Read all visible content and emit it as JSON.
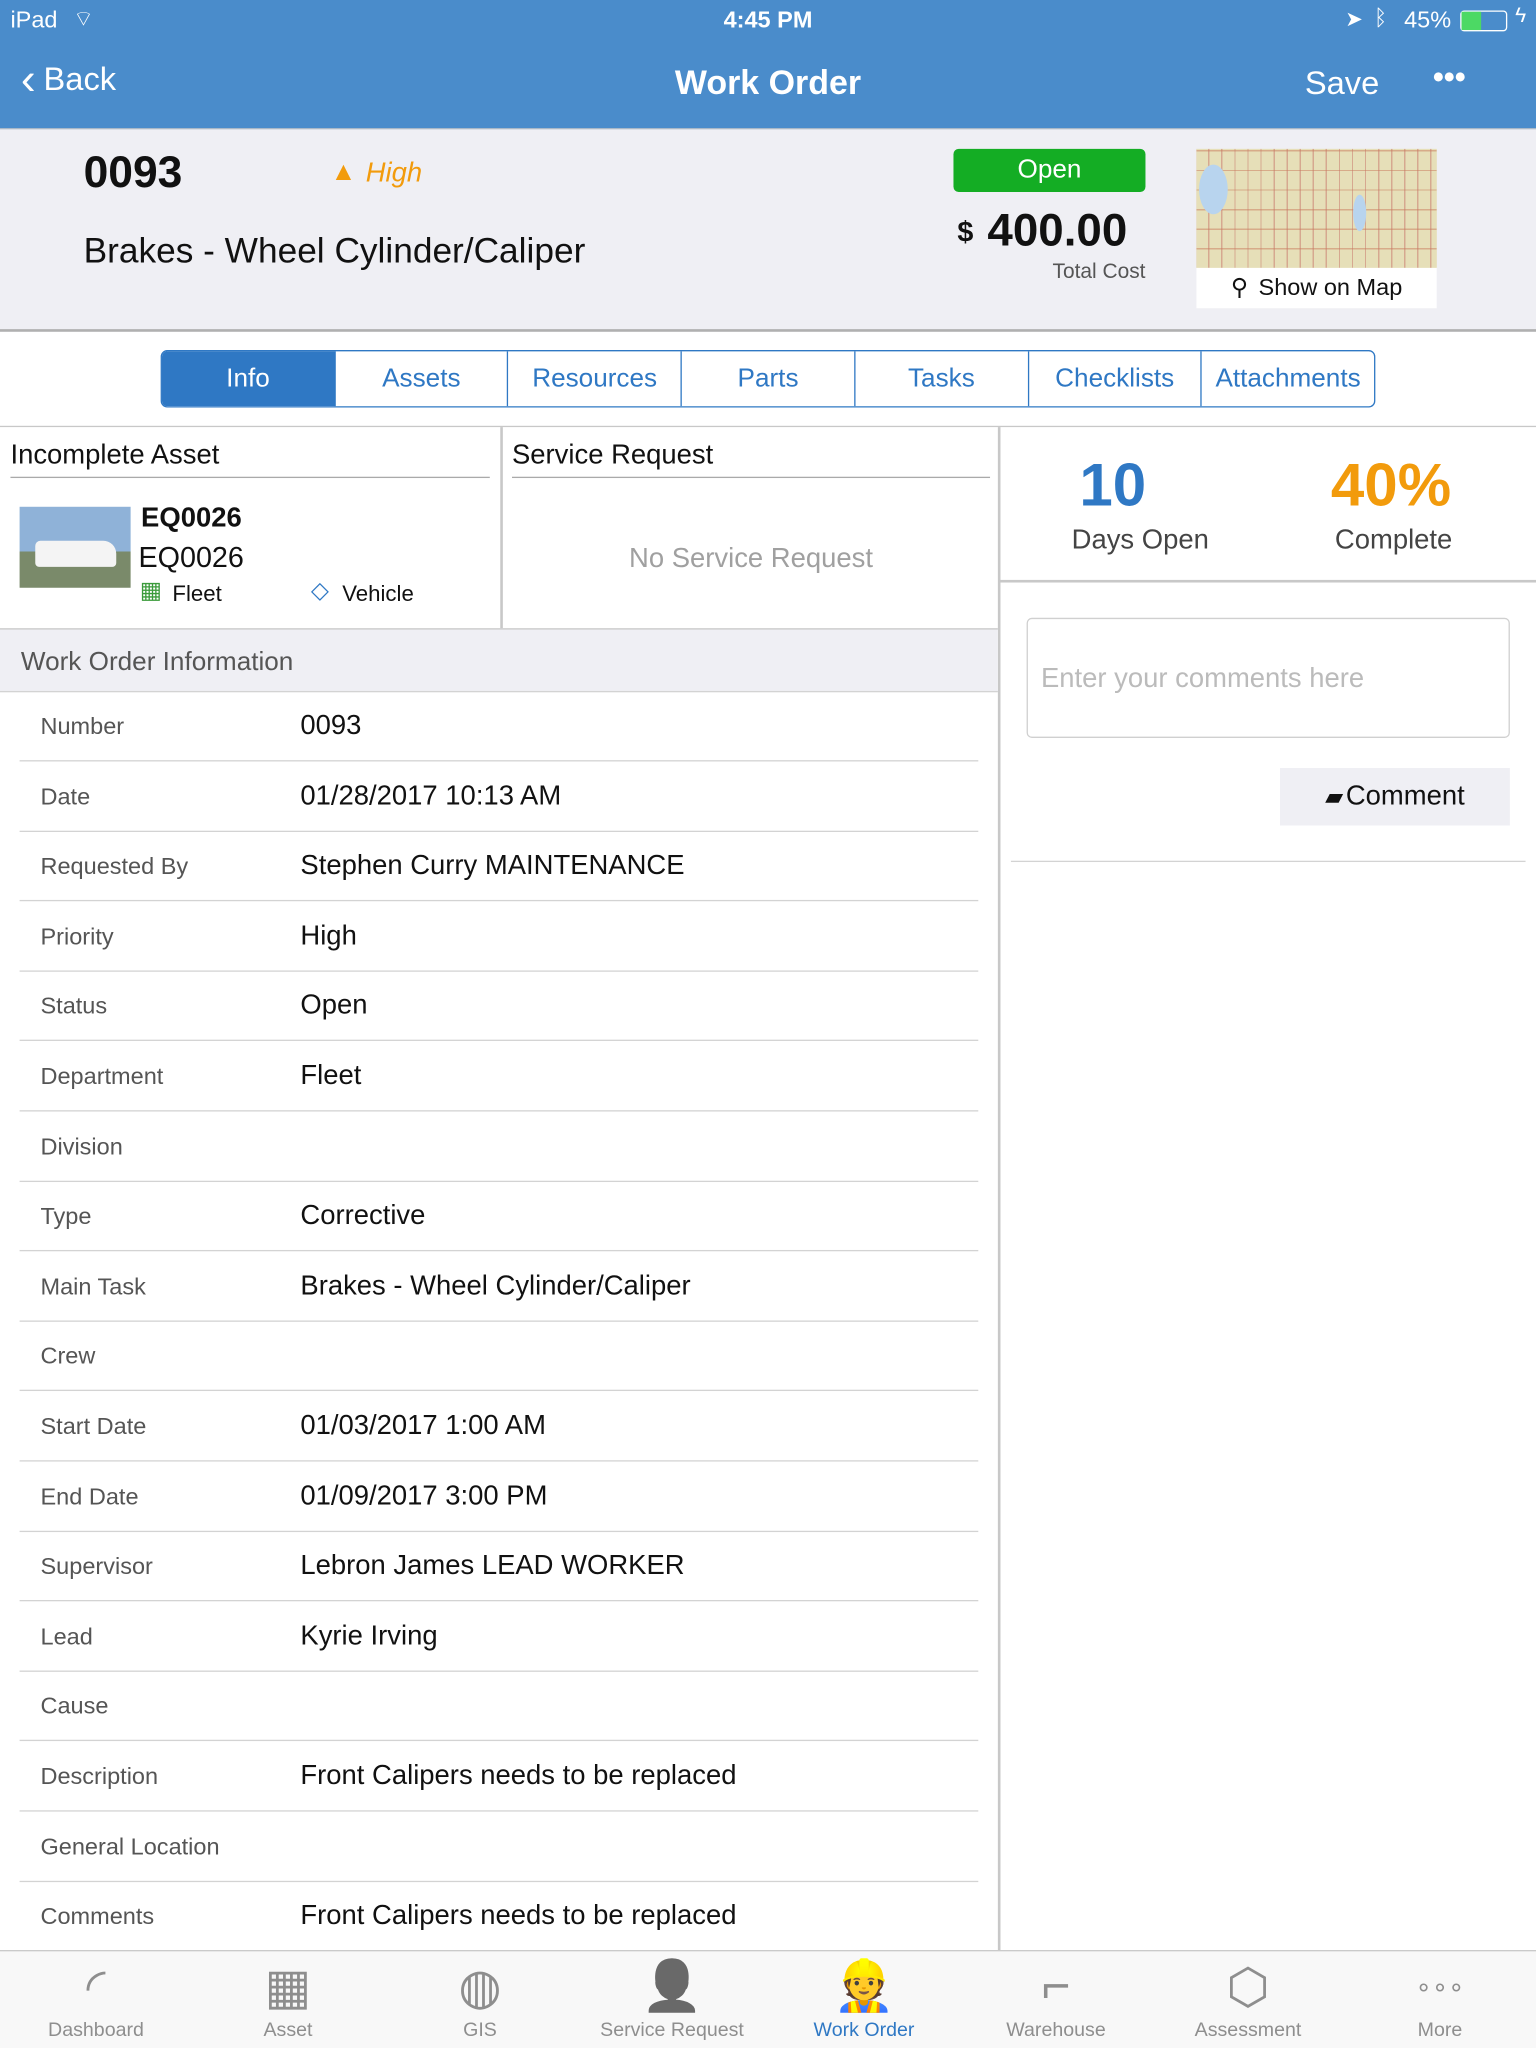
{
  "status_bar": {
    "device": "iPad",
    "time": "4:45 PM",
    "battery": "45%",
    "battery_level": 0.45
  },
  "nav": {
    "back": "Back",
    "title": "Work Order",
    "save": "Save",
    "more": "•••"
  },
  "header": {
    "number": "0093",
    "priority": "High",
    "title": "Brakes - Wheel Cylinder/Caliper",
    "status": "Open",
    "currency": "$",
    "total": "400.00",
    "total_label": "Total Cost",
    "map_button": "Show on Map",
    "colors": {
      "status": "#14ad24",
      "priority": "#f29b0c"
    }
  },
  "tabs": [
    {
      "label": "Info",
      "active": true
    },
    {
      "label": "Assets"
    },
    {
      "label": "Resources"
    },
    {
      "label": "Parts"
    },
    {
      "label": "Tasks"
    },
    {
      "label": "Checklists"
    },
    {
      "label": "Attachments"
    }
  ],
  "asset": {
    "heading": "Incomplete Asset",
    "id": "EQ0026",
    "name": "EQ0026",
    "category": "Fleet",
    "type": "Vehicle"
  },
  "service_request": {
    "heading": "Service Request",
    "empty": "No Service Request"
  },
  "stats": {
    "days": "10",
    "days_label": "Days Open",
    "percent": "40%",
    "percent_label": "Complete"
  },
  "comment": {
    "placeholder": "Enter your comments here",
    "button": "Comment"
  },
  "info": {
    "heading": "Work  Order  Information",
    "rows": [
      {
        "label": "Number",
        "value": "0093"
      },
      {
        "label": "Date",
        "value": "01/28/2017 10:13 AM"
      },
      {
        "label": "Requested By",
        "value": "Stephen Curry MAINTENANCE"
      },
      {
        "label": "Priority",
        "value": "High"
      },
      {
        "label": "Status",
        "value": "Open"
      },
      {
        "label": "Department",
        "value": "Fleet"
      },
      {
        "label": "Division",
        "value": ""
      },
      {
        "label": "Type",
        "value": "Corrective"
      },
      {
        "label": "Main Task",
        "value": "Brakes - Wheel Cylinder/Caliper"
      },
      {
        "label": "Crew",
        "value": ""
      },
      {
        "label": "Start Date",
        "value": "01/03/2017 1:00 AM"
      },
      {
        "label": "End Date",
        "value": "01/09/2017 3:00 PM"
      },
      {
        "label": "Supervisor",
        "value": "Lebron James LEAD WORKER"
      },
      {
        "label": "Lead",
        "value": "Kyrie Irving"
      },
      {
        "label": "Cause",
        "value": ""
      },
      {
        "label": "Description",
        "value": "Front Calipers needs to be replaced"
      },
      {
        "label": "General Location",
        "value": ""
      },
      {
        "label": "Comments",
        "value": "Front Calipers needs to be replaced"
      }
    ]
  },
  "tabbar": [
    {
      "label": "Dashboard",
      "icon": "gauge-icon"
    },
    {
      "label": "Asset",
      "icon": "building-icon"
    },
    {
      "label": "GIS",
      "icon": "globe-pin-icon"
    },
    {
      "label": "Service Request",
      "icon": "person-chat-icon"
    },
    {
      "label": "Work Order",
      "icon": "worker-icon",
      "active": true
    },
    {
      "label": "Warehouse",
      "icon": "pipe-icon"
    },
    {
      "label": "Assessment",
      "icon": "hands-box-icon"
    },
    {
      "label": "More",
      "icon": "more-icon"
    }
  ],
  "colors": {
    "accent": "#2f78c4",
    "navbar": "#4a8ccb",
    "percent": "#f29b0c"
  }
}
